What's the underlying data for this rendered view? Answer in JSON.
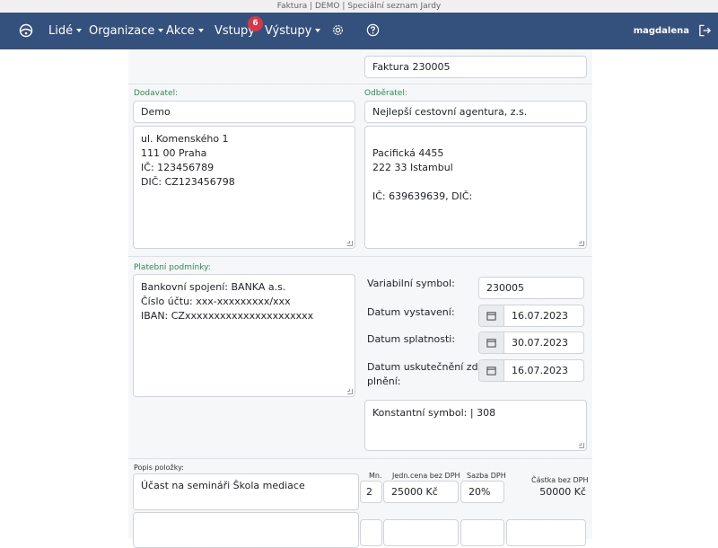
{
  "window": {
    "title": "Faktura | DEMO | Speciální seznam Jardy"
  },
  "nav": {
    "items": [
      {
        "label": "Lidé",
        "dropdown": true
      },
      {
        "label": "Organizace",
        "dropdown": true
      },
      {
        "label": "Akce",
        "dropdown": true
      },
      {
        "label": "Vstupy",
        "dropdown": false
      },
      {
        "label": "Výstupy",
        "dropdown": true
      }
    ],
    "badge_count": "6",
    "user": "magdalena",
    "icons": [
      "palette-icon",
      "gear-icon",
      "question-icon",
      "logout-icon"
    ]
  },
  "invoice": {
    "number": "Faktura 230005",
    "supplier_label": "Dodavatel:",
    "supplier_name": "Demo",
    "supplier_address": [
      "ul. Komenského 1",
      "111 00 Praha",
      "IČ: 123456789",
      "DIČ: CZ123456798"
    ],
    "customer_label": "Odběratel:",
    "customer_name": "Nejlepší cestovní agentura, z.s.",
    "customer_address": [
      "",
      "Pacifická 4455",
      "222 33 Istambul",
      "",
      "IČ: 639639639, DIČ:"
    ],
    "payment_label": "Platební podmínky:",
    "payment_terms": [
      "Bankovní spojení: BANKA a.s.",
      "Číslo účtu: xxx-xxxxxxxxx/xxx",
      "IBAN: CZxxxxxxxxxxxxxxxxxxxxxx"
    ],
    "variable_symbol_label": "Variabilní symbol:",
    "variable_symbol": "230005",
    "issue_date_label": "Datum vystavení:",
    "issue_date": "16.07.2023",
    "due_date_label": "Datum splatnosti:",
    "due_date": "30.07.2023",
    "taxable_date_label_1": "Datum uskutečnění zd.",
    "taxable_date_label_2": "plnění:",
    "taxable_date": "16.07.2023",
    "constant_symbol": "Konstantní symbol: | 308"
  },
  "items": {
    "description_label": "Popis položky:",
    "qty_label": "Mn.",
    "unit_price_label": "Jedn.cena bez DPH",
    "vat_label": "Sazba DPH",
    "total_label": "Částka bez DPH",
    "rows": [
      {
        "description": "Účast na semináři Škola mediace",
        "qty": "2",
        "unit_price": "25000 Kč",
        "vat": "20%",
        "total": "50000 Kč"
      }
    ]
  },
  "colors": {
    "navbar": "#34507c",
    "label_green": "#2e8b57",
    "badge": "#dc3545"
  }
}
